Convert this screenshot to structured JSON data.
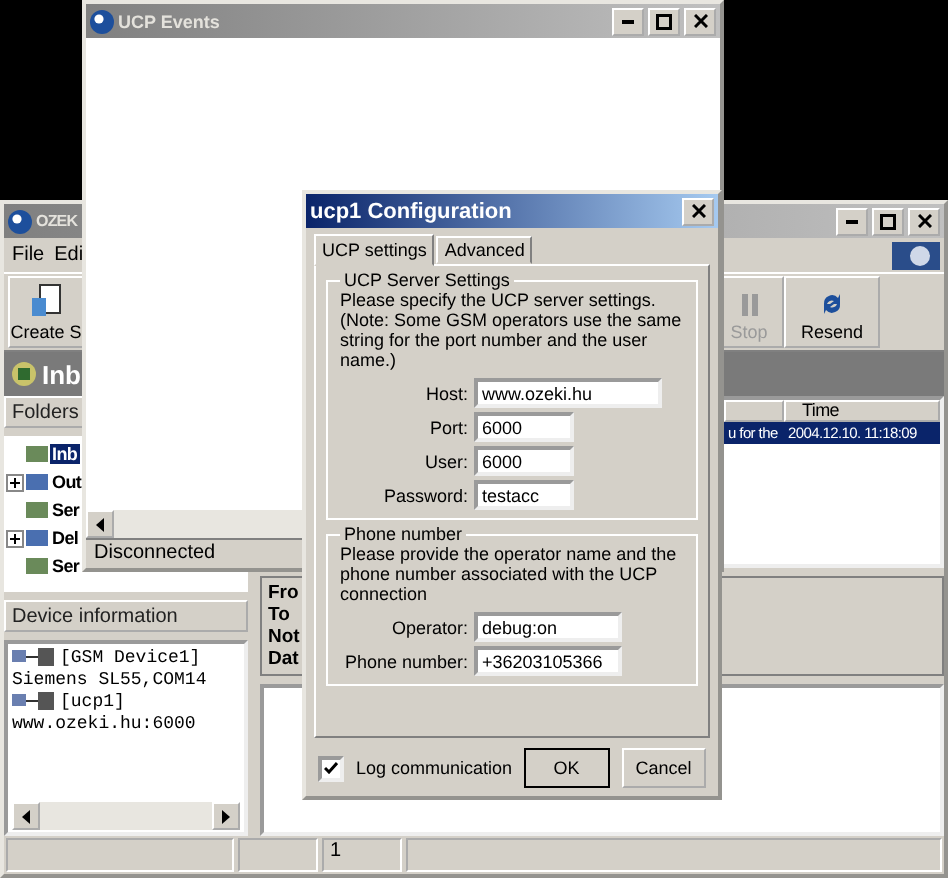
{
  "main_window": {
    "title": "OZEK",
    "menu": [
      "File",
      "Edi"
    ],
    "toolbar": [
      {
        "label": "Create S",
        "kind": "new",
        "disabled": false
      },
      {
        "label": "Stop",
        "kind": "pause",
        "disabled": true
      },
      {
        "label": "Resend",
        "kind": "resend",
        "disabled": false
      }
    ],
    "band_title": "Inb",
    "folders": {
      "header": "Folders",
      "items": [
        {
          "label": "Inb",
          "kind": "leaf",
          "selected": true
        },
        {
          "label": "Out",
          "kind": "branch",
          "selected": false
        },
        {
          "label": "Ser",
          "kind": "leaf",
          "selected": false
        },
        {
          "label": "Del",
          "kind": "branch",
          "selected": false
        },
        {
          "label": "Ser",
          "kind": "leaf",
          "selected": false
        }
      ]
    },
    "list": {
      "columns": [
        "",
        "Time"
      ],
      "rows": [
        {
          "cells": [
            "u for the",
            "2004.12.10. 11:18:09"
          ],
          "selected": true
        }
      ]
    },
    "device_info": {
      "header": "Device information",
      "lines": [
        {
          "kind": "device",
          "text": "[GSM Device1]"
        },
        {
          "kind": "detail",
          "text": "Siemens SL55,COM14"
        },
        {
          "kind": "device",
          "text": "[ucp1]"
        },
        {
          "kind": "detail",
          "text": "www.ozeki.hu:6000"
        }
      ]
    },
    "details": {
      "labels": [
        "Fro",
        "To",
        "Not",
        "Dat"
      ]
    },
    "status_bar": {
      "page": "1"
    }
  },
  "events_window": {
    "title": "UCP Events",
    "status": "Disconnected"
  },
  "dialog": {
    "title": "ucp1 Configuration",
    "tabs": [
      {
        "label": "UCP settings",
        "selected": true
      },
      {
        "label": "Advanced",
        "selected": false
      }
    ],
    "groups": [
      {
        "title": "UCP Server Settings",
        "text": "Please specify the UCP server settings. (Note: Some GSM operators use the same string for the port number and the user name.)",
        "fields": [
          {
            "label": "Host:",
            "value": "www.ozeki.hu",
            "kind": "long"
          },
          {
            "label": "Port:",
            "value": "6000",
            "kind": "short"
          },
          {
            "label": "User:",
            "value": "6000",
            "kind": "short"
          },
          {
            "label": "Password:",
            "value": "testacc",
            "kind": "short"
          }
        ]
      },
      {
        "title": "Phone number",
        "text": "Please provide the operator name and the phone number associated with the UCP connection",
        "fields": [
          {
            "label": "Operator:",
            "value": "debug:on",
            "kind": "medium"
          },
          {
            "label": "Phone number:",
            "value": "+36203105366",
            "kind": "medium"
          }
        ]
      }
    ],
    "log_communication": {
      "label": "Log communication",
      "checked": true
    },
    "buttons": [
      {
        "label": "OK",
        "default": true
      },
      {
        "label": "Cancel",
        "default": false
      }
    ]
  }
}
